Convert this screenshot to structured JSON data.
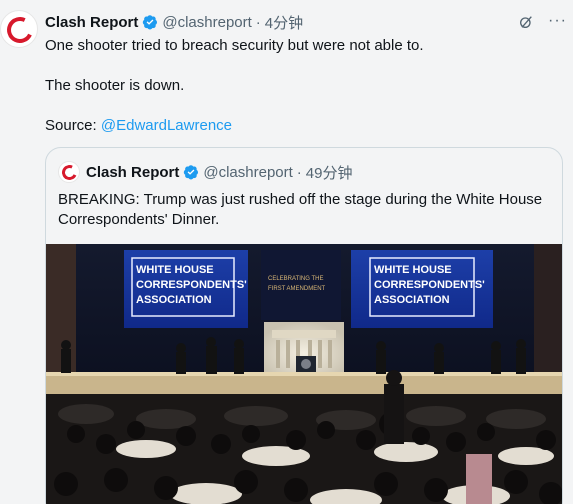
{
  "tweet": {
    "author_name": "Clash Report",
    "author_handle": "@clashreport",
    "separator": "·",
    "time": "4分钟",
    "line1": "One shooter tried to breach security but were not able to.",
    "line2": "The shooter is down.",
    "source_label": "Source: ",
    "source_link": "@EdwardLawrence"
  },
  "quote": {
    "author_name": "Clash Report",
    "author_handle": "@clashreport",
    "separator": "·",
    "time": "49分钟",
    "text": "BREAKING: Trump was just rushed off the stage during the White House Correspondents' Dinner.",
    "media": {
      "banner_left": [
        "WHITE HOUSE",
        "CORRESPONDENTS'",
        "ASSOCIATION"
      ],
      "banner_right": [
        "WHITE HOUSE",
        "CORRESPONDENTS'",
        "ASSOCIATION"
      ],
      "center_screen": [
        "CELEBRATING THE",
        "FIRST AMENDMENT"
      ]
    }
  },
  "icons": {
    "verified": "verified-badge-icon",
    "grok": "grok-icon",
    "more": "more-icon"
  },
  "colors": {
    "link": "#1d9bf0",
    "verified": "#1d9bf0",
    "brand": "#d7192c",
    "muted": "#536471"
  }
}
